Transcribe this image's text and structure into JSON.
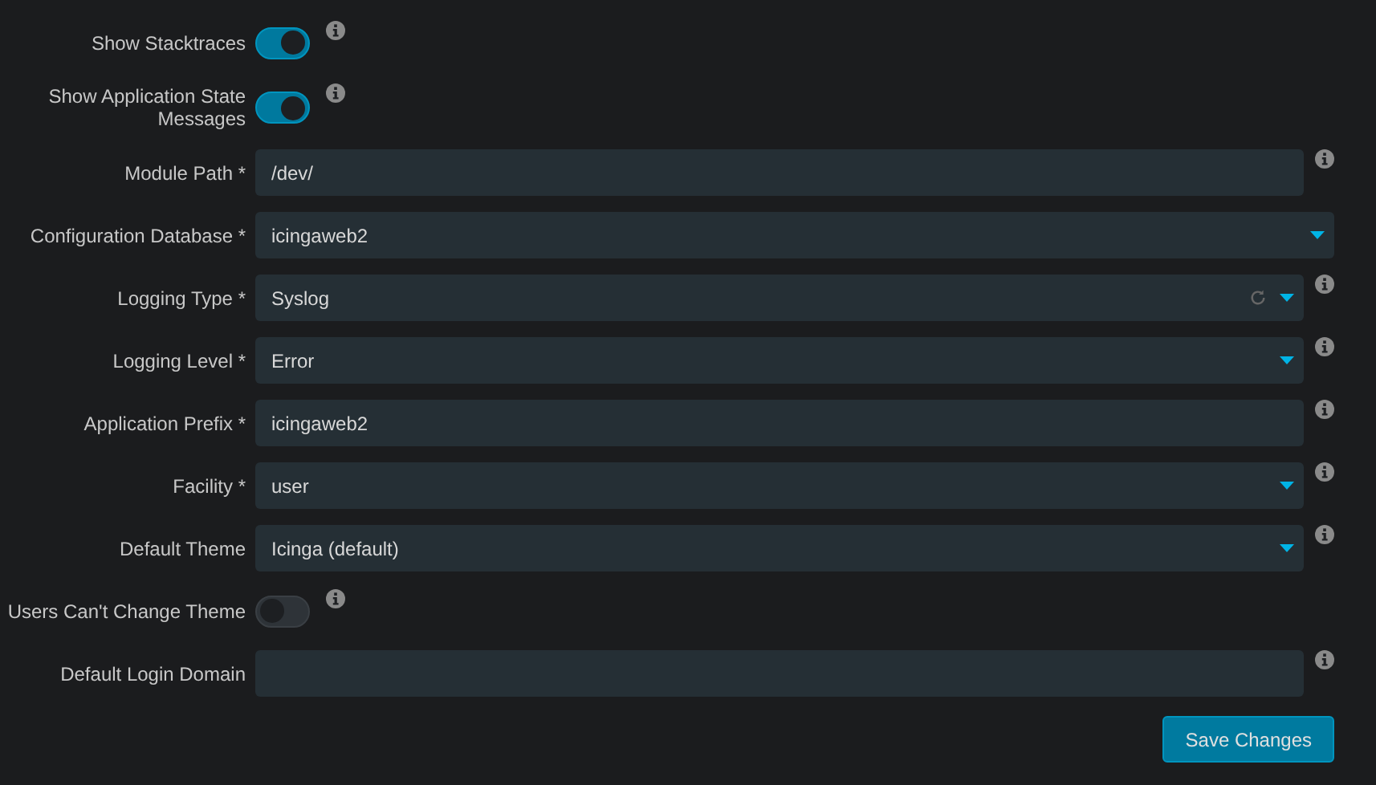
{
  "fields": [
    {
      "kind": "toggle",
      "label": "Show Stacktraces",
      "on": true,
      "help": true
    },
    {
      "kind": "toggle",
      "label": "Show Application State Messages",
      "on": true,
      "help": true
    },
    {
      "kind": "text",
      "label": "Module Path *",
      "value": "/dev/",
      "help": true
    },
    {
      "kind": "select",
      "label": "Configuration Database *",
      "value": "icingaweb2",
      "help": false,
      "reloads": false
    },
    {
      "kind": "select",
      "label": "Logging Type *",
      "value": "Syslog",
      "help": true,
      "reloads": true
    },
    {
      "kind": "select",
      "label": "Logging Level *",
      "value": "Error",
      "help": true,
      "reloads": false
    },
    {
      "kind": "text",
      "label": "Application Prefix *",
      "value": "icingaweb2",
      "help": true
    },
    {
      "kind": "select",
      "label": "Facility *",
      "value": "user",
      "help": true,
      "reloads": false
    },
    {
      "kind": "select",
      "label": "Default Theme",
      "value": "Icinga (default)",
      "help": true,
      "reloads": false
    },
    {
      "kind": "toggle",
      "label": "Users Can't Change Theme",
      "on": false,
      "help": true
    },
    {
      "kind": "text",
      "label": "Default Login Domain",
      "help": true
    }
  ],
  "submit": "Save Changes"
}
